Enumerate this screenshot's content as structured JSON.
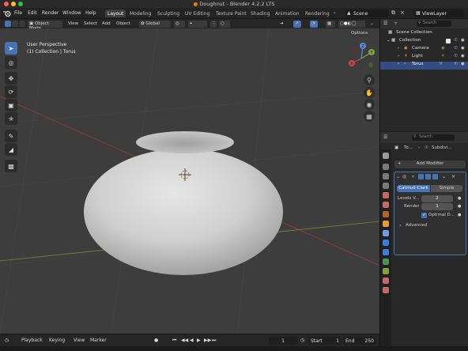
{
  "window": {
    "title": "Doughnut - Blender 4.2.2 LTS",
    "traffic_colors": [
      "#ff5f57",
      "#febc2e",
      "#28c840"
    ]
  },
  "menu": {
    "items": [
      "File",
      "Edit",
      "Render",
      "Window",
      "Help"
    ]
  },
  "workspaces": {
    "tabs": [
      "Layout",
      "Modeling",
      "Sculpting",
      "UV Editing",
      "Texture Paint",
      "Shading",
      "Animation",
      "Rendering"
    ],
    "active": "Layout"
  },
  "scene": {
    "scene_label": "Scene",
    "view_layer_label": "ViewLayer"
  },
  "viewport_header": {
    "mode": "Object Mode",
    "menu": [
      "View",
      "Select",
      "Add",
      "Object"
    ],
    "orientation": "Global",
    "options_label": "Options"
  },
  "viewport": {
    "perspective_label": "User Perspective",
    "collection_info": "(1) Collection | Torus",
    "background_color": "#3d3d3d",
    "accent_color": "#4772b3",
    "gizmo": {
      "x": "X",
      "y": "Y",
      "z": "Z"
    }
  },
  "timeline": {
    "menu": [
      "Playback",
      "Keying",
      "View",
      "Marker"
    ],
    "current_frame": "1",
    "start_label": "Start",
    "start_value": "1",
    "end_label": "End",
    "end_value": "250"
  },
  "outliner": {
    "search_placeholder": "Search",
    "root": "Scene Collection",
    "collection": "Collection",
    "objects": [
      "Camera",
      "Light",
      "Torus"
    ]
  },
  "properties": {
    "search_placeholder": "Search",
    "breadcrumb_object": "To...",
    "breadcrumb_modifier": "Subdivi...",
    "add_modifier_label": "Add Modifier",
    "mode_tabs": [
      "Catmull-Clark",
      "Simple"
    ],
    "levels_label": "Levels V...",
    "levels_value": "2",
    "render_label": "Render",
    "render_value": "1",
    "optimal_label": "Optimal D...",
    "advanced_label": "Advanced"
  }
}
